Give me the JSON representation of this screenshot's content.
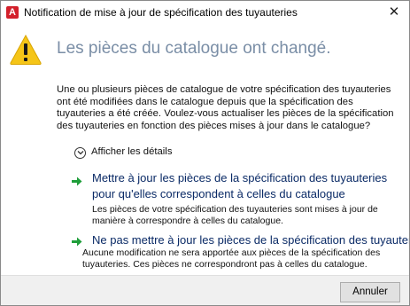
{
  "window": {
    "title": "Notification de mise à jour de spécification des tuyauteries",
    "app_icon_letter": "A",
    "close_glyph": "✕"
  },
  "header": {
    "heading": "Les pièces du catalogue ont changé.",
    "icon": "warning-icon"
  },
  "body": {
    "message": "Une ou plusieurs pièces de catalogue de votre spécification des tuyauteries ont été modifiées dans le catalogue depuis que la spécification des tuyauteries a été créée. Voulez-vous actualiser les pièces de la spécification des tuyauteries en fonction des pièces mises à jour dans le catalogue?"
  },
  "details_toggle": {
    "label": "Afficher les détails",
    "icon": "chevron-down-icon"
  },
  "options": [
    {
      "title": "Mettre à jour les pièces de la spécification des tuyauteries pour qu'elles correspondent à celles du catalogue",
      "description": "Les pièces de votre spécification des tuyauteries sont mises à jour de manière à correspondre à celles du catalogue.",
      "icon": "green-arrow-icon"
    },
    {
      "title": "Ne pas mettre à jour les pièces de la spécification des tuyauteries",
      "description": "Aucune modification ne sera apportée aux pièces de la spécification des tuyauteries. Ces pièces ne correspondront pas à celles du catalogue.",
      "icon": "green-arrow-icon"
    }
  ],
  "footer": {
    "cancel_label": "Annuler"
  },
  "colors": {
    "heading": "#7a8ea6",
    "option_title": "#0a2a66",
    "arrow": "#1f9e3a",
    "app_icon": "#d3202b",
    "warning_fill": "#f5c518"
  }
}
